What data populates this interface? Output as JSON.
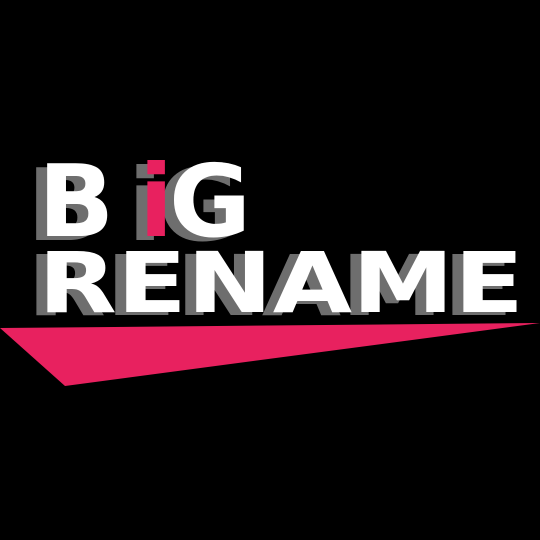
{
  "logo": {
    "line1_b": "B",
    "line1_i": "i",
    "line1_g": "G",
    "line2": "RENAME"
  },
  "colors": {
    "background": "#000000",
    "text": "#ffffff",
    "accent": "#e8215f",
    "shadow": "#6e6e6e"
  }
}
